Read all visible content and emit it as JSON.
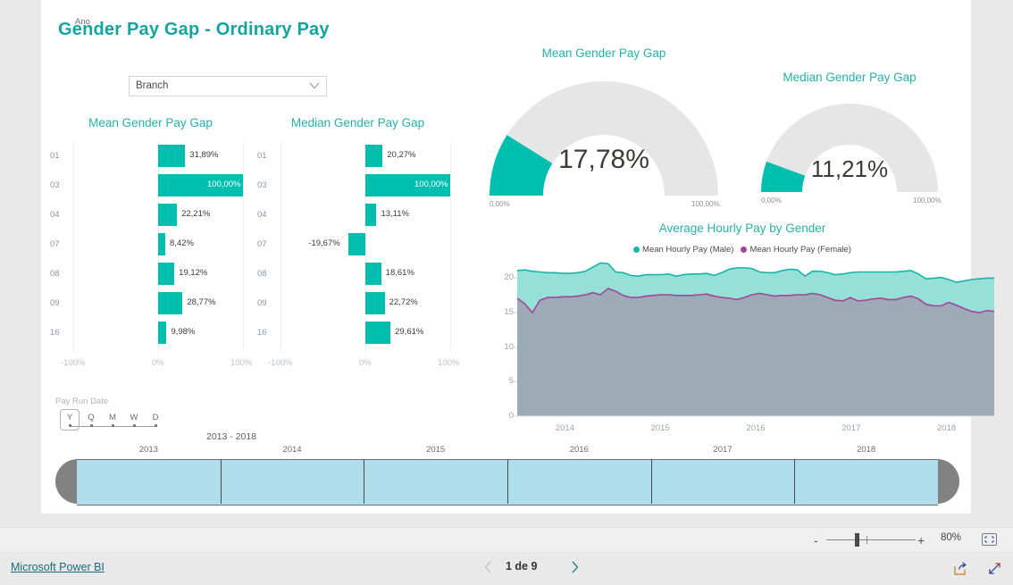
{
  "report": {
    "title": "Gender Pay Gap - Ordinary Pay",
    "accent": "#00bfae",
    "title_color": "#12a5a0"
  },
  "slicer": {
    "name": "branch-slicer",
    "label": "Branch",
    "icon": "chevron-down-icon"
  },
  "charts": {
    "mean_bar": {
      "title": "Mean Gender Pay Gap",
      "categories": [
        "01",
        "03",
        "04",
        "07",
        "08",
        "09",
        "16"
      ],
      "values": [
        31.89,
        100.0,
        22.21,
        8.42,
        19.12,
        28.77,
        9.98
      ],
      "labels": [
        "31,89%",
        "100,00%",
        "22,21%",
        "8,42%",
        "19,12%",
        "28,77%",
        "9,98%"
      ],
      "axis_ticks": [
        "-100%",
        "0%",
        "100%"
      ],
      "xlim": [
        -100,
        100
      ]
    },
    "median_bar": {
      "title": "Median Gender Pay Gap",
      "categories": [
        "01",
        "03",
        "04",
        "07",
        "08",
        "09",
        "16"
      ],
      "values": [
        20.27,
        100.0,
        13.11,
        -19.67,
        18.61,
        22.72,
        29.61
      ],
      "labels": [
        "20,27%",
        "100,00%",
        "13,11%",
        "-19,67%",
        "18,61%",
        "22,72%",
        "29,61%"
      ],
      "axis_ticks": [
        "-100%",
        "0%",
        "100%"
      ],
      "xlim": [
        -100,
        100
      ]
    },
    "mean_gauge": {
      "title": "Mean Gender Pay Gap",
      "value": 17.78,
      "value_label": "17,78%",
      "min_label": "0,00%",
      "max_label": "100,00%",
      "min": 0,
      "max": 100
    },
    "median_gauge": {
      "title": "Median Gender Pay Gap",
      "value": 11.21,
      "value_label": "11,21%",
      "min_label": "0,00%",
      "max_label": "100,00%",
      "min": 0,
      "max": 100
    }
  },
  "chart_data": [
    {
      "type": "bar",
      "title": "Mean Gender Pay Gap",
      "orientation": "horizontal",
      "categories": [
        "01",
        "03",
        "04",
        "07",
        "08",
        "09",
        "16"
      ],
      "values": [
        31.89,
        100.0,
        22.21,
        8.42,
        19.12,
        28.77,
        9.98
      ],
      "xlabel": "",
      "ylabel": "",
      "xlim": [
        -100,
        100
      ],
      "xticks": [
        -100,
        0,
        100
      ],
      "xticklabels": [
        "-100%",
        "0%",
        "100%"
      ],
      "grid": true,
      "legend": "none",
      "color": "#00bfae"
    },
    {
      "type": "bar",
      "title": "Median Gender Pay Gap",
      "orientation": "horizontal",
      "categories": [
        "01",
        "03",
        "04",
        "07",
        "08",
        "09",
        "16"
      ],
      "values": [
        20.27,
        100.0,
        13.11,
        -19.67,
        18.61,
        22.72,
        29.61
      ],
      "xlabel": "",
      "ylabel": "",
      "xlim": [
        -100,
        100
      ],
      "xticks": [
        -100,
        0,
        100
      ],
      "xticklabels": [
        "-100%",
        "0%",
        "100%"
      ],
      "grid": true,
      "legend": "none",
      "color": "#00bfae"
    },
    {
      "type": "gauge",
      "title": "Mean Gender Pay Gap",
      "value": 17.78,
      "min": 0,
      "max": 100,
      "value_label": "17,78%",
      "color": "#00bfae",
      "track_color": "#e6e6e6"
    },
    {
      "type": "gauge",
      "title": "Median Gender Pay Gap",
      "value": 11.21,
      "min": 0,
      "max": 100,
      "value_label": "11,21%",
      "color": "#00bfae",
      "track_color": "#e6e6e6"
    },
    {
      "type": "area",
      "title": "Average Hourly Pay by Gender",
      "xlabel": "",
      "ylabel": "",
      "ylim": [
        0,
        22
      ],
      "yticks": [
        0,
        5,
        10,
        15,
        20
      ],
      "yticklabels": [
        "0",
        "5",
        "10",
        "15",
        "20"
      ],
      "xticklabels": [
        "2014",
        "2015",
        "2016",
        "2017",
        "2018"
      ],
      "grid": false,
      "legend": "top",
      "series": [
        {
          "name": "Mean Hourly Pay (Male)",
          "color": "#16b5a8",
          "fill": "#96e0d8",
          "values": [
            21.1,
            21.2,
            21.0,
            20.9,
            20.8,
            20.8,
            20.7,
            20.7,
            20.8,
            21.0,
            21.6,
            22.2,
            22.1,
            20.9,
            20.8,
            20.4,
            20.3,
            20.5,
            20.5,
            20.5,
            20.6,
            20.3,
            20.5,
            20.6,
            20.6,
            20.7,
            20.4,
            20.8,
            21.3,
            21.5,
            21.5,
            21.4,
            20.9,
            20.8,
            20.8,
            21.1,
            21.3,
            21.2,
            20.3,
            21.0,
            21.0,
            20.8,
            20.5,
            20.6,
            20.8,
            20.9,
            20.9,
            20.9,
            20.9,
            20.9,
            20.9,
            21.0,
            21.1,
            20.6,
            19.9,
            20.0,
            20.1,
            19.8,
            19.4,
            19.6,
            19.8,
            19.9,
            20.0,
            20.0
          ]
        },
        {
          "name": "Mean Hourly Pay (Female)",
          "color": "#a4449a",
          "fill": "#9cabb5",
          "values": [
            17.1,
            16.3,
            15.0,
            16.8,
            17.2,
            17.2,
            17.3,
            17.3,
            17.4,
            17.6,
            17.9,
            17.6,
            18.5,
            18.1,
            17.5,
            17.2,
            17.2,
            17.4,
            17.5,
            17.6,
            17.6,
            17.5,
            17.5,
            17.5,
            17.6,
            17.7,
            17.4,
            17.2,
            17.1,
            16.9,
            17.2,
            17.6,
            17.8,
            17.6,
            17.4,
            17.5,
            17.5,
            17.6,
            17.6,
            17.8,
            17.6,
            17.2,
            16.8,
            16.7,
            17.2,
            16.7,
            16.8,
            17.0,
            17.1,
            16.9,
            16.9,
            17.2,
            17.4,
            17.0,
            16.2,
            16.0,
            16.0,
            16.5,
            16.1,
            15.6,
            15.2,
            15.0,
            15.3,
            15.2
          ]
        }
      ]
    }
  ],
  "timeline": {
    "header": "Pay Run Date",
    "granularities": [
      "Y",
      "Q",
      "M",
      "W",
      "D"
    ],
    "selected_granularity": "Y",
    "unit_label": "Ano",
    "range_label": "2013 - 2018",
    "years": [
      "2013",
      "2014",
      "2015",
      "2016",
      "2017",
      "2018"
    ]
  },
  "zoombar": {
    "minus": "-",
    "plus": "+",
    "percent": "80%",
    "fit_icon": "fit-to-page-icon"
  },
  "footer": {
    "brand": "Microsoft Power BI",
    "page_label": "1 de 9",
    "prev_icon": "chevron-left-icon",
    "next_icon": "chevron-right-icon",
    "share_icon": "share-icon",
    "fullscreen_icon": "fullscreen-icon"
  }
}
